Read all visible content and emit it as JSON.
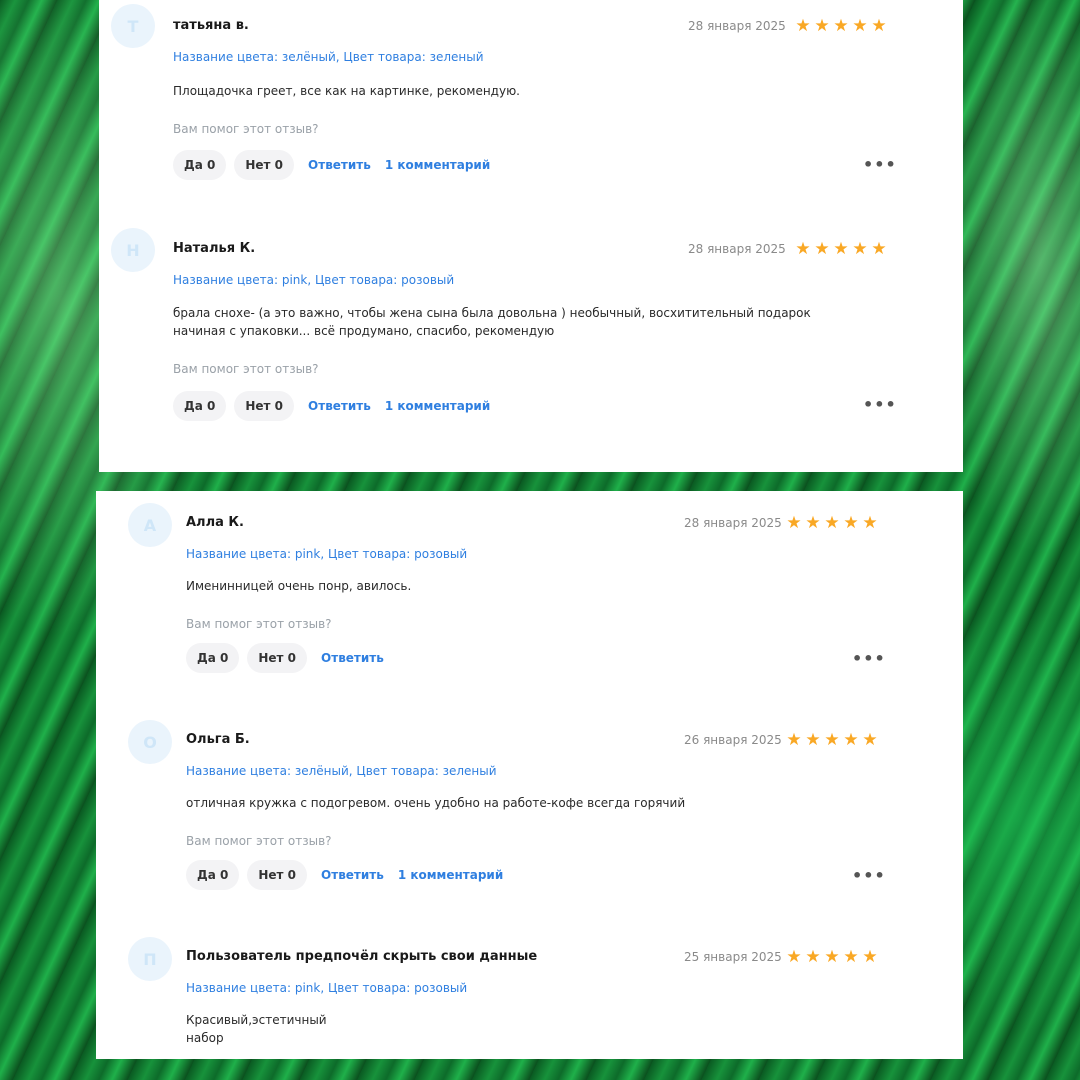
{
  "helpful_prompt": "Вам помог этот отзыв?",
  "yes_label": "Да",
  "no_label": "Нет",
  "reply_label": "Ответить",
  "star_glyph": "★",
  "more_glyph": "•••",
  "colors": {
    "link": "#2f7fe0",
    "star": "#f9a825",
    "avatar_bg": "#eaf4fc"
  },
  "reviews": [
    {
      "avatar_letter": "Т",
      "author": "татьяна в.",
      "date": "28 января 2025",
      "rating": 5,
      "variant": "Название цвета: зелёный, Цвет товара: зеленый",
      "text": "Площадочка греет, все как на картинке, рекомендую.",
      "yes_count": "0",
      "no_count": "0",
      "comments": "1 комментарий"
    },
    {
      "avatar_letter": "Н",
      "author": "Наталья К.",
      "date": "28 января 2025",
      "rating": 5,
      "variant": "Название цвета: pink, Цвет товара: розовый",
      "text": "брала снохе- (а это важно, чтобы жена сына была довольна ) необычный, восхитительный подарок начиная с упаковки... всё продумано, спасибо, рекомендую",
      "yes_count": "0",
      "no_count": "0",
      "comments": "1 комментарий"
    },
    {
      "avatar_letter": "А",
      "author": "Алла К.",
      "date": "28 января 2025",
      "rating": 5,
      "variant": "Название цвета: pink, Цвет товара: розовый",
      "text": "Именинницей очень понр, авилось.",
      "yes_count": "0",
      "no_count": "0",
      "comments": ""
    },
    {
      "avatar_letter": "О",
      "author": "Ольга Б.",
      "date": "26 января 2025",
      "rating": 5,
      "variant": "Название цвета: зелёный, Цвет товара: зеленый",
      "text": "отличная кружка с подогревом. очень удобно на работе-кофе всегда горячий",
      "yes_count": "0",
      "no_count": "0",
      "comments": "1 комментарий"
    },
    {
      "avatar_letter": "П",
      "author": "Пользователь предпочёл скрыть свои данные",
      "date": "25 января 2025",
      "rating": 5,
      "variant": "Название цвета: pink, Цвет товара: розовый",
      "text_line1": "Красивый,эстетичный",
      "text_line2": "набор"
    }
  ]
}
